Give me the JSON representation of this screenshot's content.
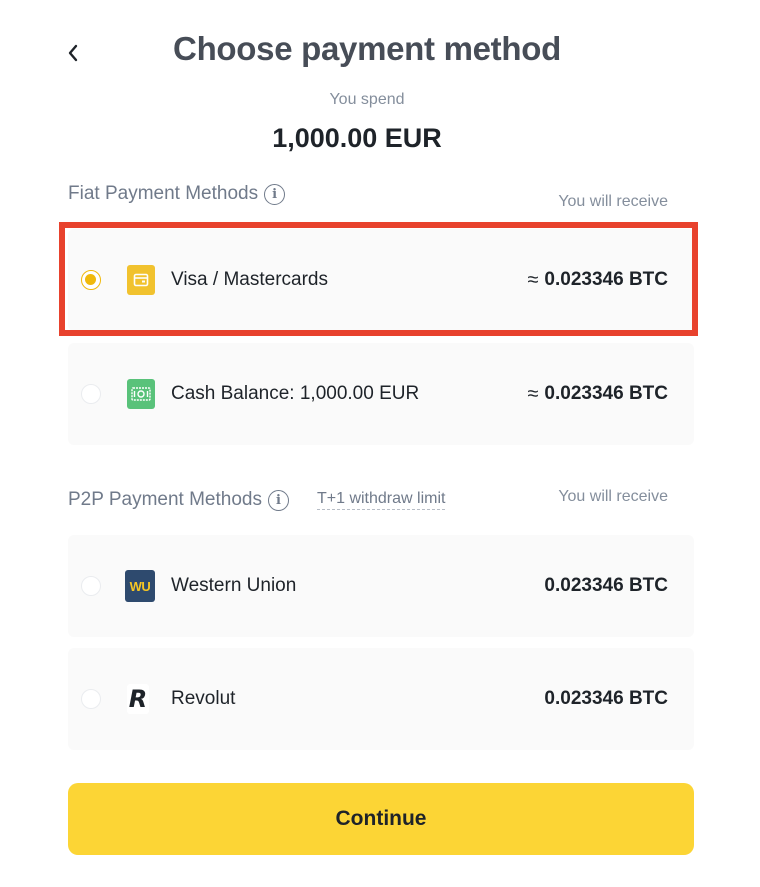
{
  "header": {
    "back_icon": "chevron-left-icon",
    "title": "Choose payment method"
  },
  "spend": {
    "label": "You spend",
    "amount": "1,000.00 EUR"
  },
  "fiat": {
    "heading": "Fiat Payment Methods",
    "info_icon": "i",
    "receive_label": "You will receive",
    "methods": [
      {
        "name": "Visa / Mastercards",
        "icon": "card-icon",
        "approx": "≈",
        "value": "0.023346 BTC",
        "selected": true,
        "icon_color": "#f0b90b"
      },
      {
        "name": "Cash Balance: 1,000.00 EUR",
        "icon": "cash-icon",
        "approx": "≈",
        "value": "0.023346 BTC",
        "selected": false,
        "icon_color": "#59c27a"
      }
    ]
  },
  "p2p": {
    "heading": "P2P Payment Methods",
    "info_icon": "i",
    "limit_link": "T+1  withdraw limit",
    "receive_label": "You will receive",
    "methods": [
      {
        "name": "Western Union",
        "icon": "western-union-logo",
        "icon_text": "WU",
        "value": "0.023346 BTC",
        "selected": false,
        "icon_color": "#2e4a6e"
      },
      {
        "name": "Revolut",
        "icon": "revolut-logo",
        "icon_text": "R",
        "value": "0.023346 BTC",
        "selected": false
      }
    ]
  },
  "colors": {
    "accent": "#fcd535",
    "radio_selected": "#f0b90b",
    "highlight": "#e8422d"
  },
  "continue_label": "Continue"
}
